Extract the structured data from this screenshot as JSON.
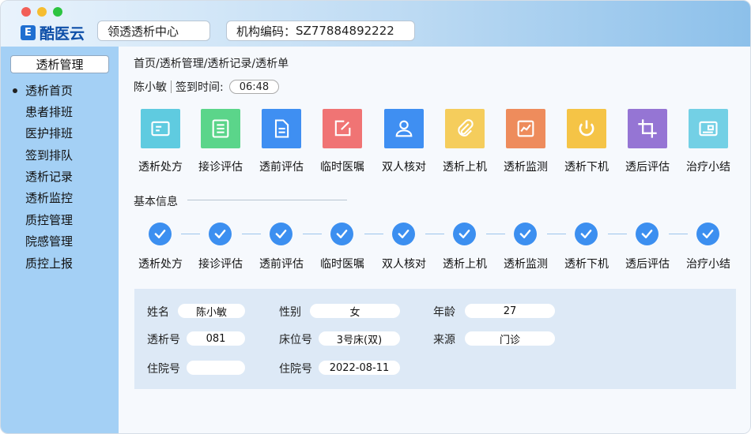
{
  "app": {
    "logo_mark": "E",
    "logo_text": "酷医云",
    "center_name": "领透透析中心",
    "org_code_label": "机构编码：",
    "org_code_value": "SZ77884892222"
  },
  "sidebar": {
    "title": "透析管理",
    "items": [
      {
        "label": "透析首页",
        "active": true
      },
      {
        "label": "患者排班"
      },
      {
        "label": "医护排班"
      },
      {
        "label": "签到排队"
      },
      {
        "label": "透析记录"
      },
      {
        "label": "透析监控"
      },
      {
        "label": "质控管理"
      },
      {
        "label": "院感管理"
      },
      {
        "label": "质控上报"
      }
    ]
  },
  "breadcrumb": "首页/透析管理/透析记录/透析单",
  "patient": {
    "name": "陈小敏",
    "checkin_label": "签到时间:",
    "checkin_time": "06:48"
  },
  "modules": [
    {
      "label": "透析处方",
      "color": "#5fcbe0",
      "icon": "card-icon"
    },
    {
      "label": "接诊评估",
      "color": "#5bd58a",
      "icon": "list-icon"
    },
    {
      "label": "透前评估",
      "color": "#3f8ff2",
      "icon": "document-icon"
    },
    {
      "label": "临时医嘱",
      "color": "#f07474",
      "icon": "edit-icon"
    },
    {
      "label": "双人核对",
      "color": "#3f8ff2",
      "icon": "users-icon"
    },
    {
      "label": "透析上机",
      "color": "#f5cd5c",
      "icon": "paperclip-icon"
    },
    {
      "label": "透析监测",
      "color": "#ee8c5c",
      "icon": "chart-icon"
    },
    {
      "label": "透析下机",
      "color": "#f5c446",
      "icon": "power-icon"
    },
    {
      "label": "透后评估",
      "color": "#9575d4",
      "icon": "crop-icon"
    },
    {
      "label": "治疗小结",
      "color": "#73d0e5",
      "icon": "id-card-icon"
    }
  ],
  "basic_info_title": "基本信息",
  "steps": [
    "透析处方",
    "接诊评估",
    "透前评估",
    "临时医嘱",
    "双人核对",
    "透析上机",
    "透析监测",
    "透析下机",
    "透后评估",
    "治疗小结"
  ],
  "info": {
    "name_label": "姓名",
    "name_value": "陈小敏",
    "gender_label": "性别",
    "gender_value": "女",
    "age_label": "年龄",
    "age_value": "27",
    "dialysis_no_label": "透析号",
    "dialysis_no_value": "081",
    "bed_label": "床位号",
    "bed_value": "3号床(双)",
    "source_label": "来源",
    "source_value": "门诊",
    "inpatient_no_label": "住院号",
    "inpatient_no_value": "",
    "inpatient_date_label": "住院号",
    "inpatient_date_value": "2022-08-11"
  }
}
